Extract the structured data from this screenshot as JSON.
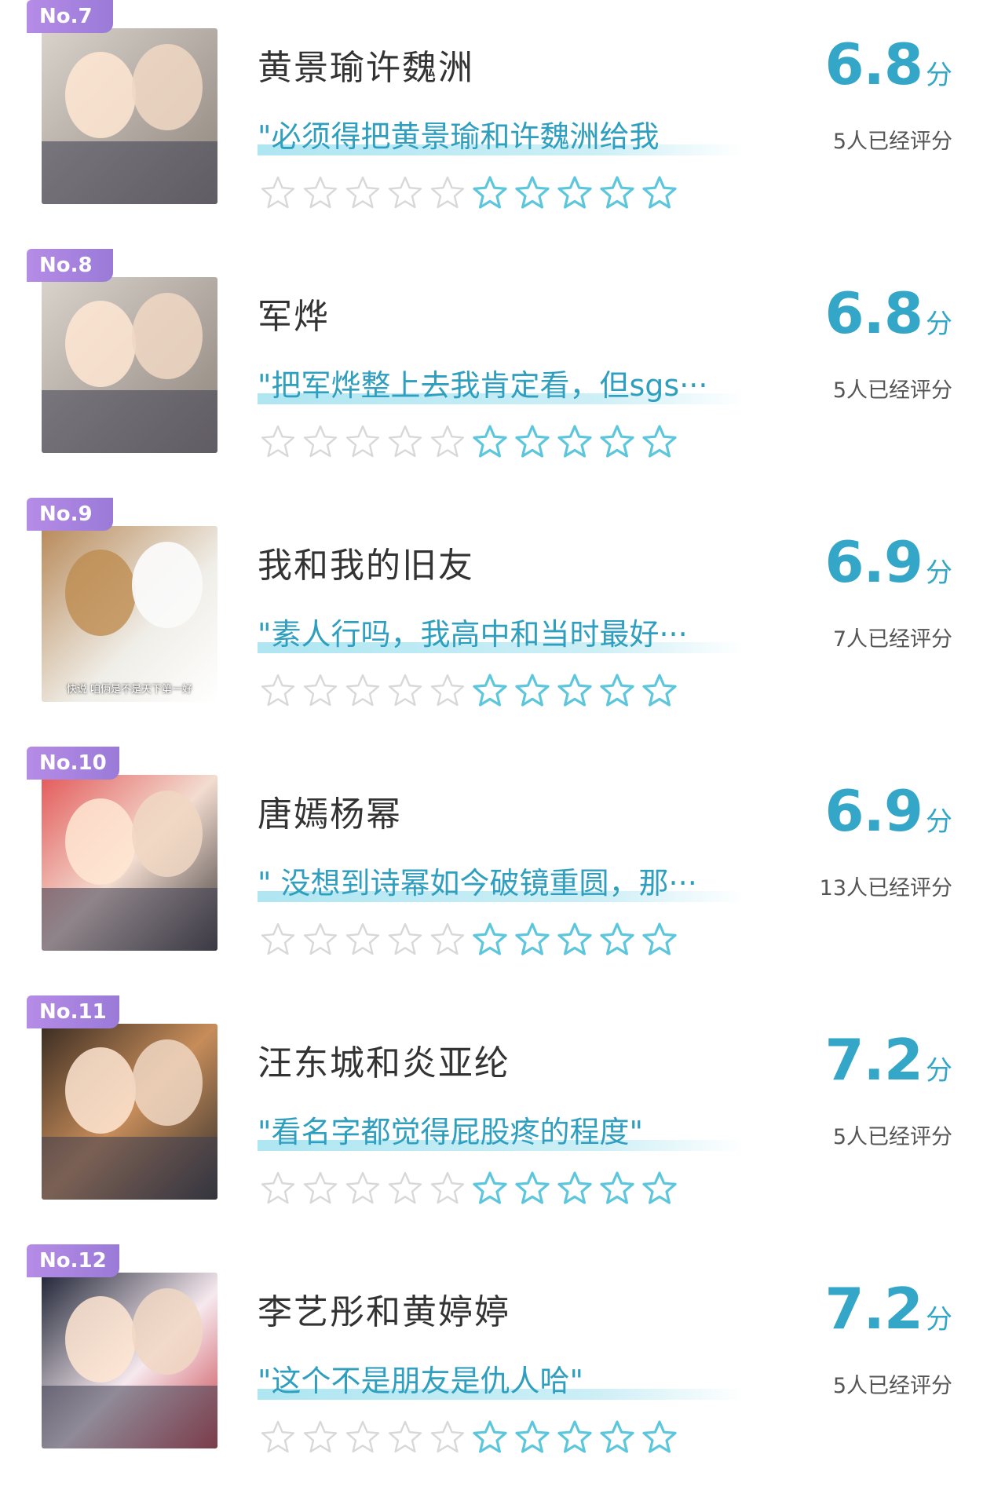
{
  "items": [
    {
      "rank": "No.7",
      "title": "黄景瑜许魏洲",
      "quote": "\"必须得把黄景瑜和许魏洲给我",
      "score": "6.8",
      "unit": "分",
      "raters": "5人已经评分",
      "rating_stars_empty": 5,
      "rating_stars_filled": 5,
      "thumb_icon": "photo-thumbnail"
    },
    {
      "rank": "No.8",
      "title": "军烨",
      "quote": "\"把军烨整上去我肯定看，但sgs···",
      "score": "6.8",
      "unit": "分",
      "raters": "5人已经评分",
      "rating_stars_empty": 5,
      "rating_stars_filled": 5,
      "thumb_icon": "photo-thumbnail"
    },
    {
      "rank": "No.9",
      "title": "我和我的旧友",
      "quote": "\"素人行吗，我高中和当时最好···",
      "score": "6.9",
      "unit": "分",
      "raters": "7人已经评分",
      "rating_stars_empty": 5,
      "rating_stars_filled": 5,
      "thumb_icon": "photo-thumbnail",
      "thumb_caption": "快说 咱俩是不是天下第一好"
    },
    {
      "rank": "No.10",
      "title": "唐嫣杨幂",
      "quote": "\" 没想到诗幂如今破镜重圆，那···",
      "score": "6.9",
      "unit": "分",
      "raters": "13人已经评分",
      "rating_stars_empty": 5,
      "rating_stars_filled": 5,
      "thumb_icon": "photo-thumbnail"
    },
    {
      "rank": "No.11",
      "title": "汪东城和炎亚纶",
      "quote": "\"看名字都觉得屁股疼的程度\"",
      "score": "7.2",
      "unit": "分",
      "raters": "5人已经评分",
      "rating_stars_empty": 5,
      "rating_stars_filled": 5,
      "thumb_icon": "photo-thumbnail"
    },
    {
      "rank": "No.12",
      "title": "李艺彤和黄婷婷",
      "quote": "\"这个不是朋友是仇人哈\"",
      "score": "7.2",
      "unit": "分",
      "raters": "5人已经评分",
      "rating_stars_empty": 5,
      "rating_stars_filled": 5,
      "thumb_icon": "photo-thumbnail"
    }
  ],
  "colors": {
    "accent": "#34a7c8",
    "badge": "#a884e0",
    "star_empty": "#d8d8d8",
    "star_filled": "#5cc6dc"
  }
}
